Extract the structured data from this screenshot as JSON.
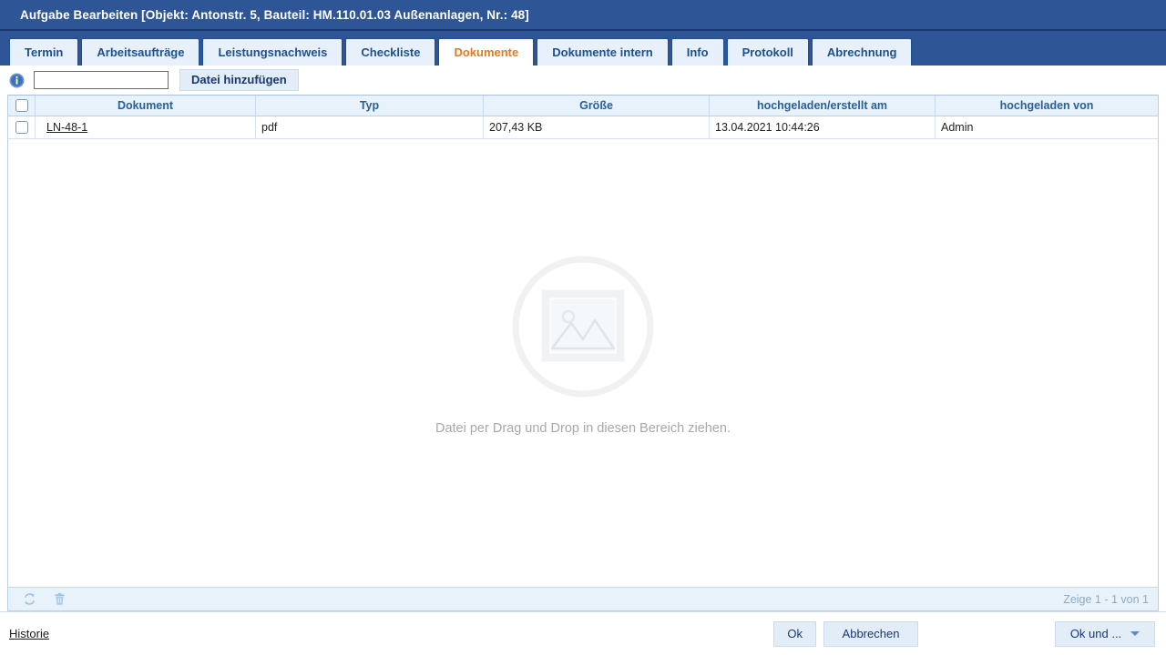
{
  "window": {
    "title": "Aufgabe Bearbeiten [Objekt: Antonstr. 5, Bauteil: HM.110.01.03 Außenanlagen, Nr.: 48]"
  },
  "colors": {
    "titlebar_bg": "#2e5596",
    "tab_active_text": "#e07b23",
    "tab_text": "#1d4f91",
    "header_text": "#2a6099",
    "status_text": "#8fa9c2"
  },
  "tabs": [
    {
      "label": "Termin",
      "active": false
    },
    {
      "label": "Arbeitsaufträge",
      "active": false
    },
    {
      "label": "Leistungsnachweis",
      "active": false
    },
    {
      "label": "Checkliste",
      "active": false
    },
    {
      "label": "Dokumente",
      "active": true
    },
    {
      "label": "Dokumente intern",
      "active": false
    },
    {
      "label": "Info",
      "active": false
    },
    {
      "label": "Protokoll",
      "active": false
    },
    {
      "label": "Abrechnung",
      "active": false
    }
  ],
  "toolbar": {
    "info_icon": "info-icon",
    "search_value": "",
    "search_placeholder": "",
    "add_file_label": "Datei hinzufügen"
  },
  "grid": {
    "select_all_icon": "checkbox-icon",
    "columns": [
      "Dokument",
      "Typ",
      "Größe",
      "hochgeladen/erstellt am",
      "hochgeladen von"
    ],
    "rows": [
      {
        "document": "LN-48-1",
        "typ": "pdf",
        "groesse": "207,43 KB",
        "hochgeladen_am": "13.04.2021 10:44:26",
        "hochgeladen_von": "Admin"
      }
    ]
  },
  "dropzone": {
    "icon": "image-placeholder-icon",
    "text": "Datei per Drag und Drop in diesen Bereich ziehen."
  },
  "statusbar": {
    "refresh_icon": "refresh-icon",
    "delete_icon": "trash-icon",
    "count_text": "Zeige 1 - 1 von 1"
  },
  "footer": {
    "history_label": "Historie",
    "ok_label": "Ok",
    "cancel_label": "Abbrechen",
    "ok_and_label": "Ok und ..."
  }
}
